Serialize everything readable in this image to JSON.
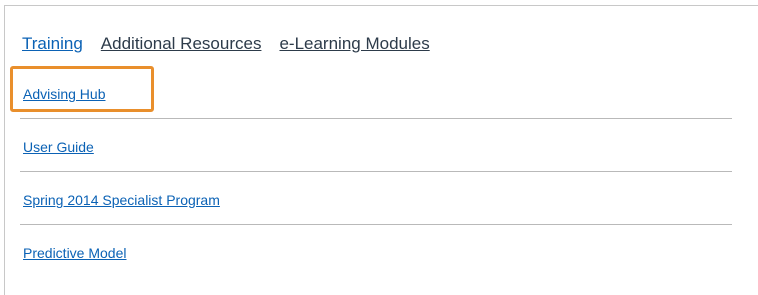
{
  "tabs": {
    "items": [
      {
        "label": "Training"
      },
      {
        "label": "Additional Resources"
      },
      {
        "label": "e-Learning Modules"
      }
    ]
  },
  "links": {
    "items": [
      {
        "label": "Advising Hub"
      },
      {
        "label": "User Guide"
      },
      {
        "label": "Spring 2014 Specialist Program"
      },
      {
        "label": "Predictive Model"
      }
    ]
  },
  "colors": {
    "link": "#0b62b5",
    "tab_inactive": "#2d3b4a",
    "highlight": "#e98f2c",
    "divider": "#b9b9b9"
  }
}
